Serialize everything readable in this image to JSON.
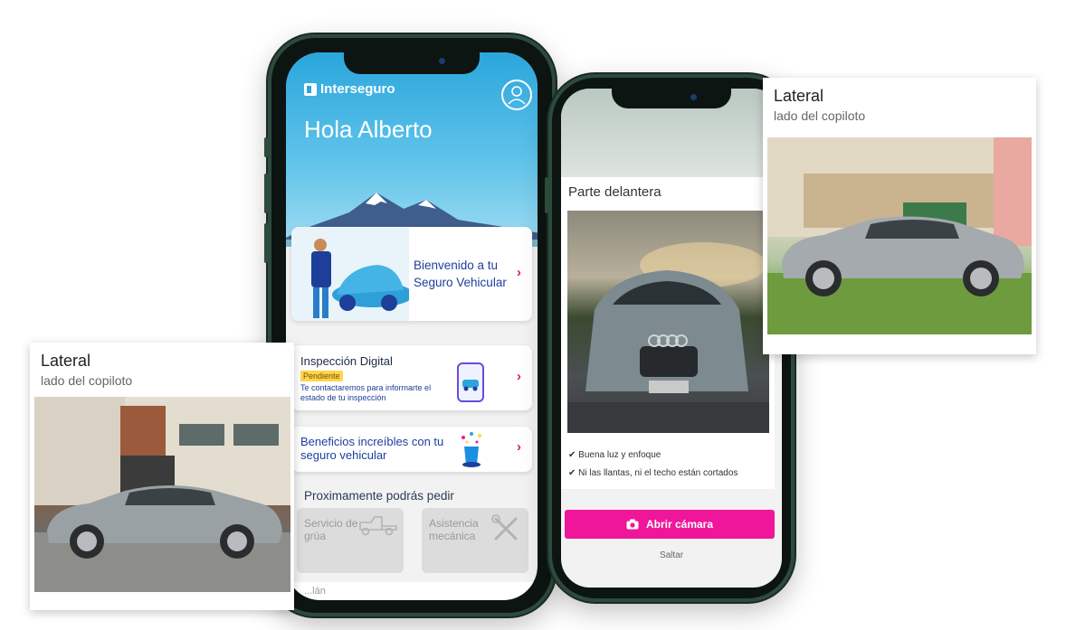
{
  "phone_home": {
    "brand": "Interseguro",
    "greeting": "Hola Alberto",
    "welcome_card": {
      "title": "Bienvenido a tu Seguro Vehicular"
    },
    "inspection_card": {
      "title": "Inspección Digital",
      "badge": "Pendiente",
      "description": "Te contactaremos para informarte el estado de tu inspección"
    },
    "benefits_card": {
      "title": "Beneficios increíbles con tu seguro vehicular"
    },
    "coming_soon": {
      "title": "Proximamente podrás pedir",
      "services": [
        "Servicio de grúa",
        "Asistencia mecánica"
      ]
    },
    "footer_partial": "...lán"
  },
  "phone_camera": {
    "section_title": "Parte delantera",
    "checks": [
      "Buena luz y enfoque",
      "Ni las llantas, ni el techo están cortados"
    ],
    "camera_button": "Abrir cámara",
    "skip": "Saltar"
  },
  "card_left": {
    "title": "Lateral",
    "subtitle": "lado del  copiloto"
  },
  "card_right": {
    "title": "Lateral",
    "subtitle": "lado del  copiloto"
  },
  "colors": {
    "brand_blue": "#1d3f9a",
    "sky": "#2aa6dc",
    "accent_pink": "#f0169b",
    "badge_yellow": "#ffd54a"
  },
  "icons": [
    "user-icon",
    "chevron-right-icon",
    "phone-car-icon",
    "magic-hat-icon",
    "tow-truck-icon",
    "tools-icon",
    "camera-icon",
    "check-icon"
  ]
}
